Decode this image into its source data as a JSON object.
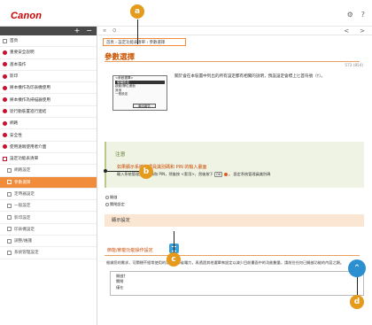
{
  "brand": "Canon",
  "top_icons": {
    "settings": "⚙",
    "help": "?"
  },
  "nav": {
    "expand_symbol": "+",
    "collapse_symbol": "−",
    "items": [
      {
        "label": "首頁",
        "icon": "square"
      },
      {
        "label": "重要安全說明",
        "icon": "red-dot"
      },
      {
        "label": "基本操作",
        "icon": "red-dot"
      },
      {
        "label": "影印",
        "icon": "red-dot"
      },
      {
        "label": "將本機作為印表機使用",
        "icon": "red-dot"
      },
      {
        "label": "將本機作為掃描器使用",
        "icon": "red-dot"
      },
      {
        "label": "從行動裝置進行連結",
        "icon": "red-dot"
      },
      {
        "label": "網路",
        "icon": "red-dot"
      },
      {
        "label": "安全性",
        "icon": "red-dot"
      },
      {
        "label": "使用遠端使用者介面",
        "icon": "red-dot"
      },
      {
        "label": "設定功能表清單",
        "icon": "open-square"
      },
      {
        "label": "網路設定",
        "icon": "square",
        "sub": true
      },
      {
        "label": "參數選擇",
        "icon": "square",
        "sub": true,
        "active": true
      },
      {
        "label": "定時器設定",
        "icon": "square",
        "sub": true
      },
      {
        "label": "一般設定",
        "icon": "square",
        "sub": true
      },
      {
        "label": "影印設定",
        "icon": "square",
        "sub": true
      },
      {
        "label": "印表機設定",
        "icon": "square",
        "sub": true
      },
      {
        "label": "調整/維護",
        "icon": "square",
        "sub": true
      },
      {
        "label": "系統管理設定",
        "icon": "square",
        "sub": true
      }
    ]
  },
  "toolbar": {
    "menu_icon": "≡",
    "search_icon": "Q",
    "prev": "<",
    "next": ">"
  },
  "breadcrumb": "首頁 › 設定功能表清單 › 參數選擇",
  "page": {
    "title": "參數選擇",
    "page_number": "573 (854)",
    "mini_screen": {
      "rows": [
        "<參數選擇>",
        "螢幕設定",
        "啟動/歸位畫面",
        "其他",
        "一般設定"
      ],
      "selected": 1,
      "button": "輸出報告"
    },
    "intro": "關於會在本裝置中列出的所有設定都有相關的說明，預設設定會標上匕首符號（†）。",
    "note": {
      "title": "注意",
      "heading": "如果顯示系統管理員識別碼和 PIN 的輸入畫面",
      "body_prefix": "輸入系統管理員識別碼和 PIN，然後按 <套用>，然後按下",
      "key": "OK",
      "body_suffix": "。 設定系統管理員識別碼"
    },
    "options": [
      "開啟",
      "關閉設定"
    ],
    "section": "顯示設定",
    "subsection": {
      "heading": "節能/節能功能操作設定",
      "body": "根據您的需求，可關閉不經常使用的功能以節省電力，再透過其他選單來設定以減少目前畫面中的功能數量，請前往任何已開啟功能的內容之類。",
      "values": [
        "開啟†",
        "關閉",
        "僅在"
      ]
    }
  },
  "scroll_top_symbol": "⌃",
  "callouts": [
    "a",
    "b",
    "c",
    "d"
  ]
}
